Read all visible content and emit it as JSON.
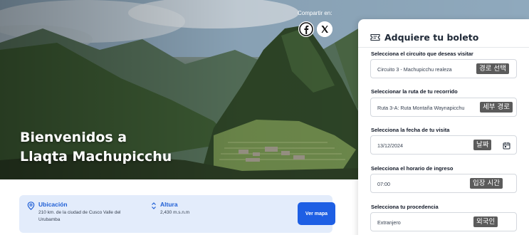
{
  "hero": {
    "title_line1": "Bienvenidos a",
    "title_line2": "Llaqta Machupicchu",
    "share_label": "Compartir en:",
    "share_icons": [
      "facebook-icon",
      "x-icon"
    ]
  },
  "info": {
    "location_label": "Ubicación",
    "location_text": "210 km. de la ciudad de Cusco Valle del Urubamba",
    "altitude_label": "Altura",
    "altitude_text": "2,430 m.s.n.m",
    "map_button": "Ver mapa"
  },
  "booking": {
    "title": "Adquiere tu boleto",
    "fields": [
      {
        "label": "Selecciona el circuito que deseas visitar",
        "value": "Circuito 3 - Machupicchu realeza",
        "tag": "경로 선택"
      },
      {
        "label": "Seleccionar la ruta de tu recorrido",
        "value": "Ruta 3-A: Ruta Montaña Waynapicchu",
        "tag": "세부 경로"
      },
      {
        "label": "Selecciona la fecha de tu visita",
        "value": "13/12/2024",
        "tag": "날짜"
      },
      {
        "label": "Selecciona el horario de ingreso",
        "value": "07:00",
        "tag": "입장 시간"
      },
      {
        "label": "Selecciona tu procedencia",
        "value": "Extranjero",
        "tag": "외국인"
      }
    ]
  },
  "colors": {
    "accent": "#1e5fe4",
    "info_bg": "#e3ecfb",
    "tag_bg": "#5b5b5b"
  }
}
